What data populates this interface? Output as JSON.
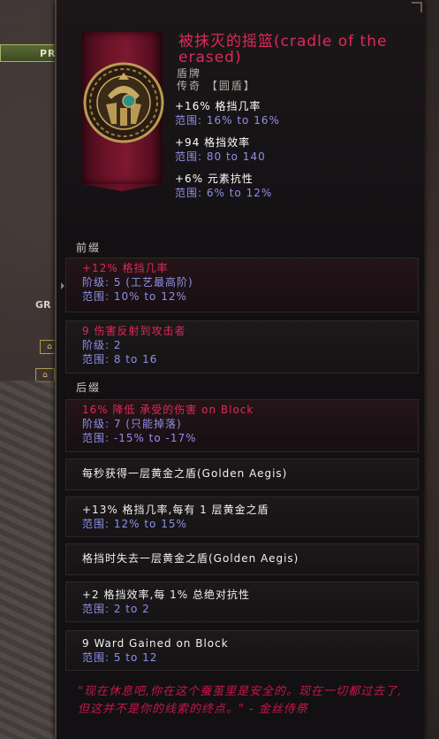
{
  "background": {
    "bar_label": "PR",
    "side_label": "GR"
  },
  "item": {
    "name": "被抹灭的摇篮(cradle of the erased)",
    "base_type": "盾牌",
    "rarity_line": "传奇 【圆盾】",
    "icon": "shield-emblem-icon",
    "implicits": [
      {
        "stat": "+16% 格挡几率",
        "range": "范围: 16% to 16%"
      },
      {
        "stat": "+94 格挡效率",
        "range": "范围: 80 to 140"
      },
      {
        "stat": "+6% 元素抗性",
        "range": "范围: 6% to 12%"
      }
    ]
  },
  "prefix": {
    "heading": "前缀",
    "mods": [
      {
        "title": "+12% 格挡几率",
        "tier": "阶级: 5 (工艺最高阶)",
        "range": "范围: 10% to 12%"
      },
      {
        "title": "9 伤害反射到攻击者",
        "tier": "阶级: 2",
        "range": "范围: 8 to 16"
      }
    ]
  },
  "suffix": {
    "heading": "后缀",
    "mods": [
      {
        "title": "16% 降低 承受的伤害 on Block",
        "tier": "阶级: 7 (只能掉落)",
        "range": "范围: -15% to -17%"
      }
    ]
  },
  "uniques": [
    {
      "title": "每秒获得一层黄金之盾(Golden Aegis)"
    },
    {
      "title": "+13% 格挡几率,每有 1 层黄金之盾",
      "range": "范围: 12% to 15%"
    },
    {
      "title": "格挡时失去一层黄金之盾(Golden Aegis)"
    },
    {
      "title": "+2 格挡效率,每 1% 总绝对抗性",
      "range": "范围: 2 to 2"
    },
    {
      "title": "9 Ward Gained on Block",
      "range": "范围: 5 to 12"
    }
  ],
  "lore": "\"现在休息吧,你在这个蚕茧里是安全的。现在一切都过去了,但这并不是你的线索的终点。\" - 金丝侍祭",
  "colors": {
    "legendary_red": "#e0285a",
    "range_blue": "#8f90e8",
    "lore_red": "#c5174a"
  }
}
